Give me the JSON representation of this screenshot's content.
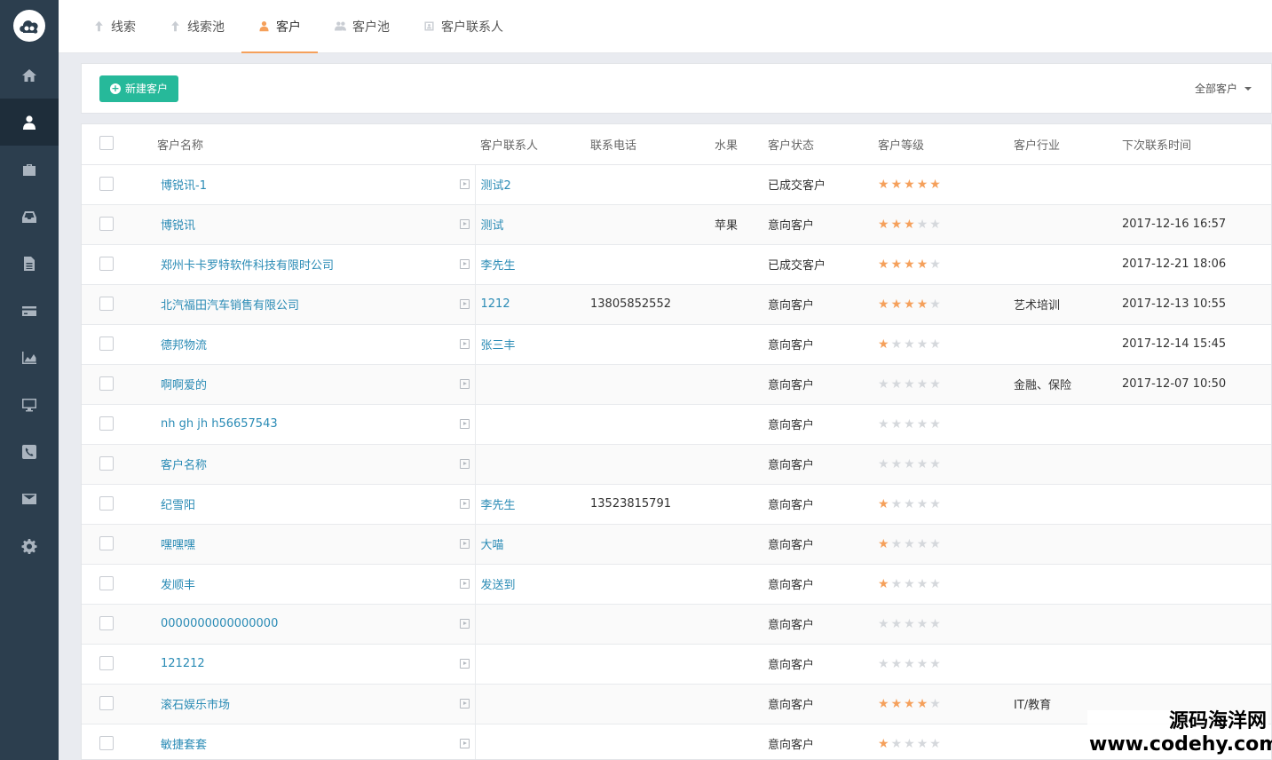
{
  "nav": [
    {
      "name": "home-icon"
    },
    {
      "name": "user-icon",
      "active": true
    },
    {
      "name": "briefcase-icon"
    },
    {
      "name": "inbox-icon"
    },
    {
      "name": "document-icon"
    },
    {
      "name": "credit-card-icon"
    },
    {
      "name": "area-chart-icon"
    },
    {
      "name": "monitor-icon"
    },
    {
      "name": "phone-icon"
    },
    {
      "name": "envelope-icon"
    },
    {
      "name": "gear-icon"
    }
  ],
  "tabs": [
    {
      "label": "线索",
      "icon": "arrow-up-icon"
    },
    {
      "label": "线索池",
      "icon": "arrow-up-icon"
    },
    {
      "label": "客户",
      "icon": "user-icon",
      "active": true
    },
    {
      "label": "客户池",
      "icon": "users-icon"
    },
    {
      "label": "客户联系人",
      "icon": "contact-card-icon"
    }
  ],
  "toolbar": {
    "new_button": "新建客户",
    "filter": "全部客户"
  },
  "columns": [
    "客户名称",
    "客户联系人",
    "联系电话",
    "水果",
    "客户状态",
    "客户等级",
    "客户行业",
    "下次联系时间"
  ],
  "accent_color": "#26b99a",
  "star_color": "#f5a05b",
  "rows": [
    {
      "name": "博锐讯-1",
      "contact": "测试2",
      "phone": "",
      "fruit": "",
      "status": "已成交客户",
      "rating": 5,
      "industry": "",
      "next": ""
    },
    {
      "name": "博锐讯",
      "contact": "测试",
      "phone": "",
      "fruit": "苹果",
      "status": "意向客户",
      "rating": 3,
      "industry": "",
      "next": "2017-12-16 16:57"
    },
    {
      "name": "郑州卡卡罗特软件科技有限时公司",
      "contact": "李先生",
      "phone": "",
      "fruit": "",
      "status": "已成交客户",
      "rating": 4,
      "industry": "",
      "next": "2017-12-21 18:06"
    },
    {
      "name": "北汽福田汽车销售有限公司",
      "contact": "1212",
      "phone": "13805852552",
      "fruit": "",
      "status": "意向客户",
      "rating": 4,
      "industry": "艺术培训",
      "next": "2017-12-13 10:55"
    },
    {
      "name": "德邦物流",
      "contact": "张三丰",
      "phone": "",
      "fruit": "",
      "status": "意向客户",
      "rating": 1,
      "industry": "",
      "next": "2017-12-14 15:45"
    },
    {
      "name": "啊啊爱的",
      "contact": "",
      "phone": "",
      "fruit": "",
      "status": "意向客户",
      "rating": 0,
      "industry": "金融、保险",
      "next": "2017-12-07 10:50"
    },
    {
      "name": "nh gh jh h56657543",
      "contact": "",
      "phone": "",
      "fruit": "",
      "status": "意向客户",
      "rating": 0,
      "industry": "",
      "next": ""
    },
    {
      "name": "客户名称",
      "contact": "",
      "phone": "",
      "fruit": "",
      "status": "意向客户",
      "rating": 0,
      "industry": "",
      "next": ""
    },
    {
      "name": "纪雪阳",
      "contact": "李先生",
      "phone": "13523815791",
      "fruit": "",
      "status": "意向客户",
      "rating": 1,
      "industry": "",
      "next": ""
    },
    {
      "name": "嘿嘿嘿",
      "contact": "大喵",
      "phone": "",
      "fruit": "",
      "status": "意向客户",
      "rating": 1,
      "industry": "",
      "next": ""
    },
    {
      "name": "发顺丰",
      "contact": "发送到",
      "phone": "",
      "fruit": "",
      "status": "意向客户",
      "rating": 1,
      "industry": "",
      "next": ""
    },
    {
      "name": "0000000000000000",
      "contact": "",
      "phone": "",
      "fruit": "",
      "status": "意向客户",
      "rating": 0,
      "industry": "",
      "next": ""
    },
    {
      "name": "121212",
      "contact": "",
      "phone": "",
      "fruit": "",
      "status": "意向客户",
      "rating": 0,
      "industry": "",
      "next": ""
    },
    {
      "name": "滚石娱乐市场",
      "contact": "",
      "phone": "",
      "fruit": "",
      "status": "意向客户",
      "rating": 4,
      "industry": "IT/教育",
      "next": ""
    },
    {
      "name": "敏捷套套",
      "contact": "",
      "phone": "",
      "fruit": "",
      "status": "意向客户",
      "rating": 1,
      "industry": "",
      "next": ""
    }
  ],
  "watermark": "源码海洋网 www.codehy.com"
}
